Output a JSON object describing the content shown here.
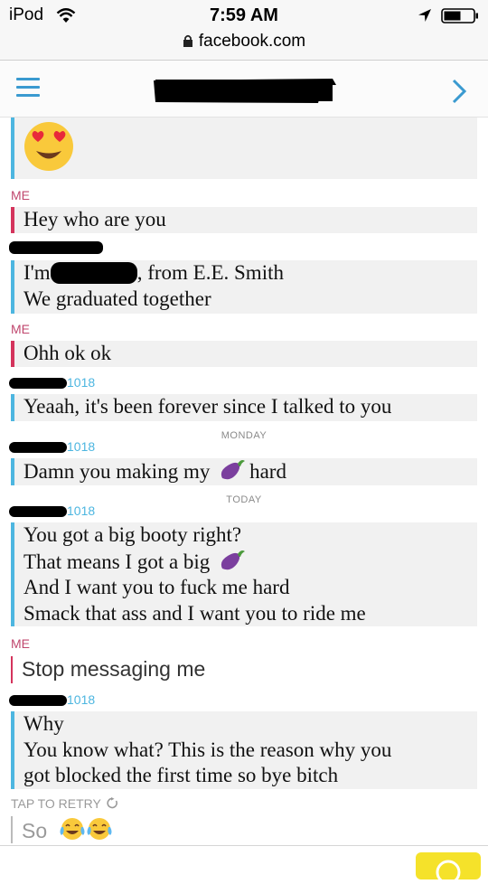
{
  "status": {
    "device": "iPod",
    "time": "7:59 AM",
    "url": "facebook.com"
  },
  "header": {
    "title": ""
  },
  "messages": {
    "m0_emoji": "heart-eyes",
    "sender_me": "ME",
    "m1": "Hey who are you",
    "m2_a": "I'm",
    "m2_b": ", from E.E. Smith",
    "m2_c": "We graduated together",
    "m3": "Ohh ok ok",
    "sender_suffix": "1018",
    "m4": "Yeaah, it's been forever since I talked to you",
    "day_monday": "MONDAY",
    "m5_a": "Damn you making my",
    "m5_b": "hard",
    "day_today": "TODAY",
    "m6_a": "You got a big booty right?",
    "m6_b": "That means I got a big",
    "m6_c": "And I want you to fuck me hard",
    "m6_d": "Smack that ass and I want you to ride me",
    "m7": "Stop messaging me",
    "m8_a": "Why",
    "m8_b": "You know what? This is the reason why you",
    "m8_c": "got blocked the first time so bye bitch",
    "retry": "TAP TO RETRY",
    "m9": "So"
  },
  "colors": {
    "other_accent": "#4db6e0",
    "me_accent": "#d4345c",
    "link_blue": "#3a9ad0",
    "send_button": "#f5e22a"
  },
  "icons": [
    "wifi-icon",
    "location-icon",
    "battery-icon",
    "lock-icon",
    "menu-icon",
    "forward-icon",
    "heart-eyes-emoji",
    "eggplant-emoji",
    "tears-of-joy-emoji",
    "retry-icon"
  ]
}
